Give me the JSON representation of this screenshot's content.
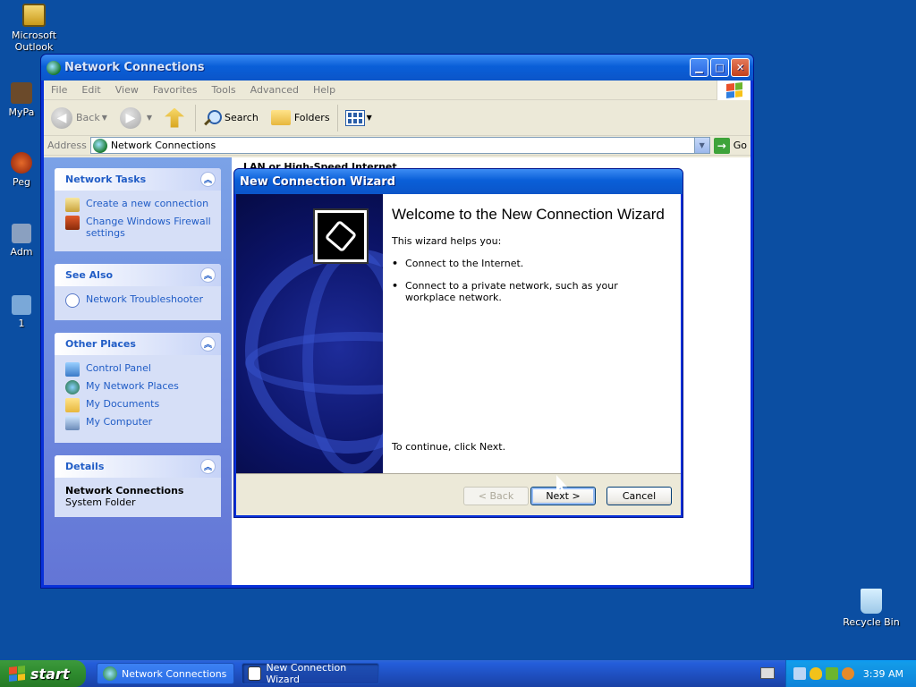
{
  "desktop": {
    "icons": [
      {
        "label": "Microsoft Outlook"
      },
      {
        "label": "MyPa"
      },
      {
        "label": "Peg"
      },
      {
        "label": "Adm"
      },
      {
        "label": "1"
      },
      {
        "label": "Recycle Bin"
      }
    ]
  },
  "window": {
    "title": "Network Connections",
    "menu": [
      "File",
      "Edit",
      "View",
      "Favorites",
      "Tools",
      "Advanced",
      "Help"
    ],
    "toolbar": {
      "back": "Back",
      "search": "Search",
      "folders": "Folders"
    },
    "address": {
      "label": "Address",
      "value": "Network Connections",
      "go": "Go"
    },
    "taskpane": {
      "network_tasks": {
        "title": "Network Tasks",
        "items": [
          "Create a new connection",
          "Change Windows Firewall settings"
        ]
      },
      "see_also": {
        "title": "See Also",
        "items": [
          "Network Troubleshooter"
        ]
      },
      "other_places": {
        "title": "Other Places",
        "items": [
          "Control Panel",
          "My Network Places",
          "My Documents",
          "My Computer"
        ]
      },
      "details": {
        "title": "Details",
        "name": "Network Connections",
        "type": "System Folder"
      }
    },
    "content": {
      "group_header": "LAN or High-Speed Internet"
    }
  },
  "wizard": {
    "title": "New Connection Wizard",
    "heading": "Welcome to the New Connection Wizard",
    "intro": "This wizard helps you:",
    "bullets": [
      "Connect to the Internet.",
      "Connect to a private network, such as your workplace network."
    ],
    "continue": "To continue, click Next.",
    "buttons": {
      "back": "< Back",
      "next": "Next >",
      "cancel": "Cancel"
    }
  },
  "taskbar": {
    "start": "start",
    "tasks": [
      "Network Connections",
      "New Connection Wizard"
    ],
    "clock": "3:39 AM"
  },
  "colors": {
    "desktop": "#0b4ea2",
    "titlebar": "#0a5fd8",
    "taskpane_link": "#215dc6",
    "start_green": "#2e8b2e"
  }
}
